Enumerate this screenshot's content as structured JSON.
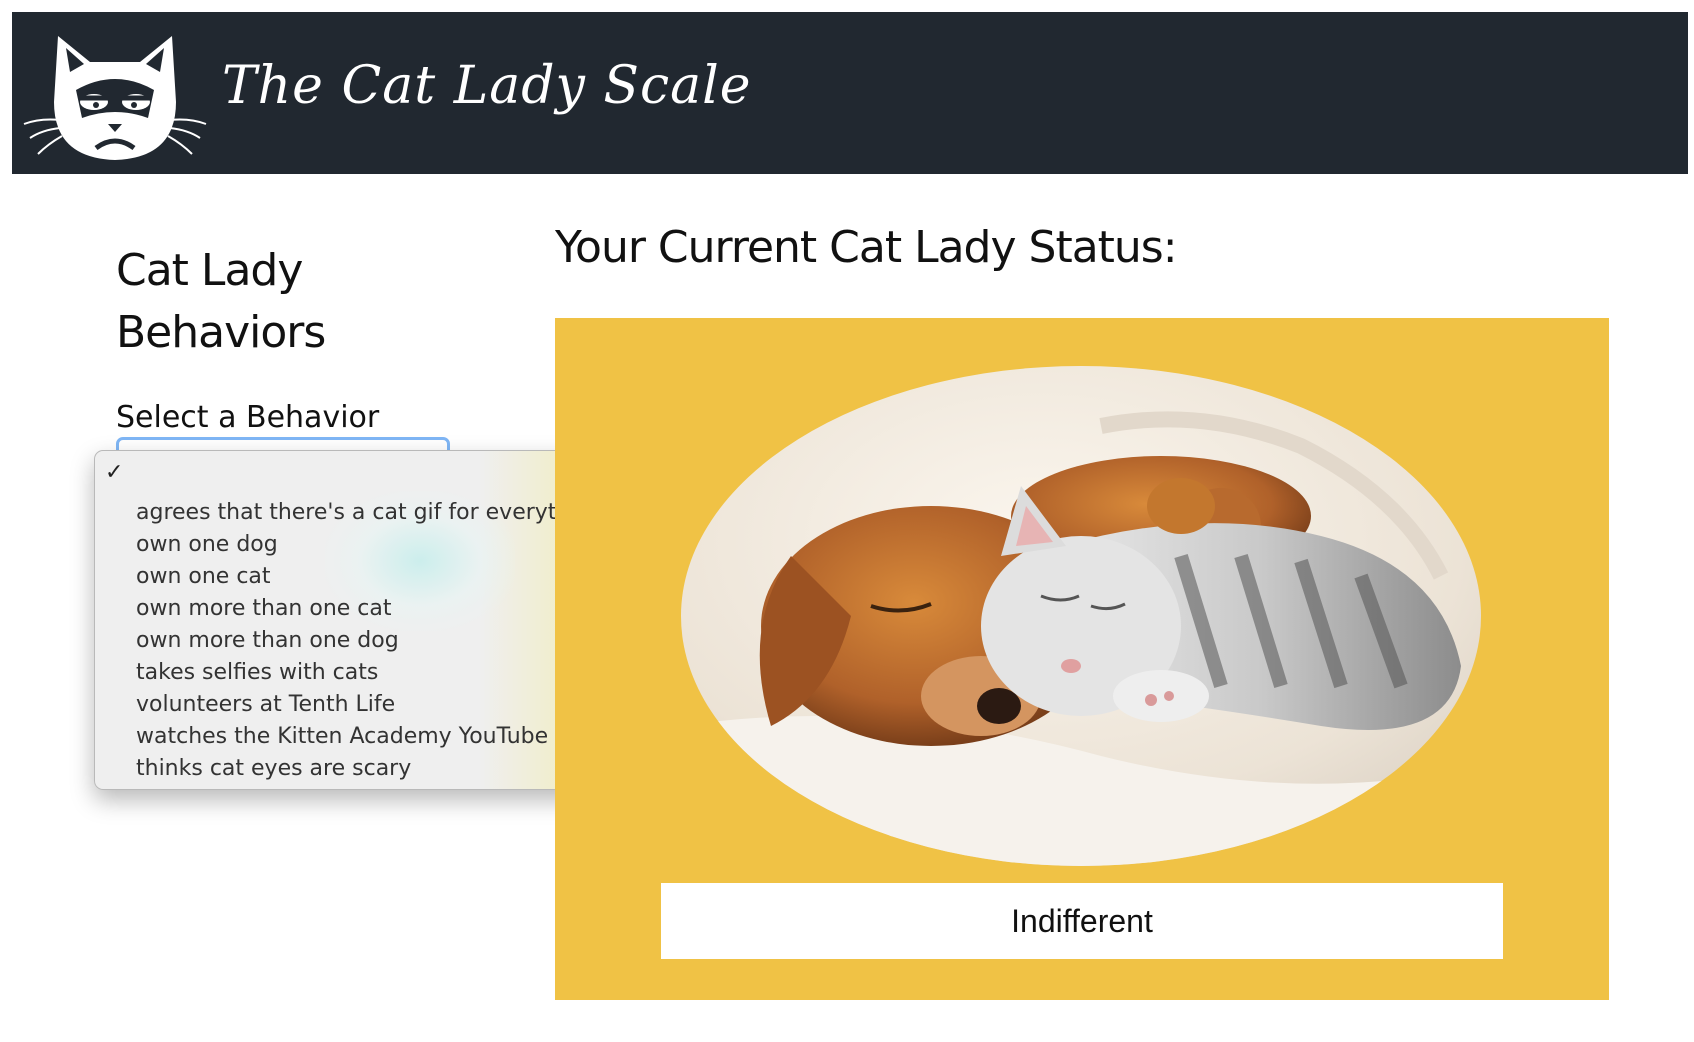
{
  "header": {
    "brand": "The Cat Lady Scale",
    "logo_icon": "grumpy-cat-icon"
  },
  "sidebar": {
    "title": "Cat Lady Behaviors",
    "select_label": "Select a Behavior",
    "select_value": "",
    "dropdown": {
      "check_glyph": "✓",
      "options": [
        "agrees that there's a cat gif for everything",
        "own one dog",
        "own one cat",
        "own more than one cat",
        "own more than one dog",
        "takes selfies with cats",
        "volunteers at Tenth Life",
        "watches the Kitten Academy YouTube channel",
        "thinks cat eyes are scary"
      ]
    }
  },
  "main": {
    "title": "Your Current Cat Lady Status:",
    "status": "Indifferent",
    "panel_color": "#f0c245"
  },
  "colors": {
    "navbar": "#212830",
    "select_focus": "#7fb6f5"
  }
}
